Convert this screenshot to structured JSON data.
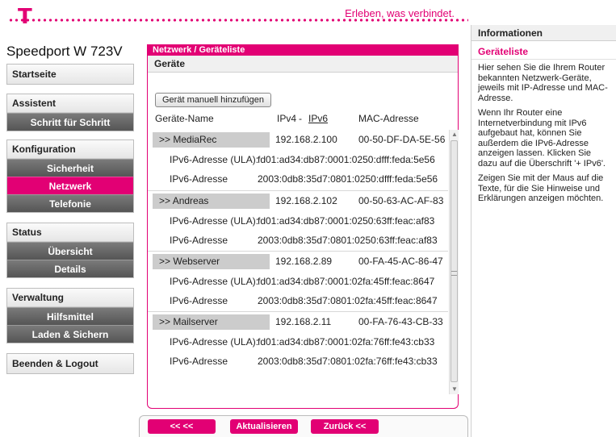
{
  "header": {
    "slogan": "Erleben, was verbindet.",
    "device": "Speedport W 723V",
    "logo": "T"
  },
  "nav": {
    "startseite": "Startseite",
    "assistent": "Assistent",
    "schritt": "Schritt für Schritt",
    "konfiguration": "Konfiguration",
    "sicherheit": "Sicherheit",
    "netzwerk": "Netzwerk",
    "telefonie": "Telefonie",
    "status": "Status",
    "uebersicht": "Übersicht",
    "details": "Details",
    "verwaltung": "Verwaltung",
    "hilfsmittel": "Hilfsmittel",
    "laden": "Laden & Sichern",
    "logout": "Beenden & Logout"
  },
  "main": {
    "breadcrumb": "Netzwerk / Geräteliste",
    "section": "Geräte",
    "add_button": "Gerät manuell hinzufügen",
    "col_name": "Geräte-Name",
    "col_ipv4": "IPv4",
    "col_sep": "-",
    "col_ipv6": "IPv6",
    "col_mac": "MAC-Adresse",
    "devices": [
      {
        "name": ">> MediaRec",
        "ip": "192.168.2.100",
        "mac": "00-50-DF-DA-5E-56",
        "ula_label": "IPv6-Adresse (ULA):",
        "ula": "fd01:ad34:db87:0001:0250:dfff:feda:5e56",
        "ipv6_label": "IPv6-Adresse",
        "ipv6": "2003:0db8:35d7:0801:0250:dfff:feda:5e56"
      },
      {
        "name": ">> Andreas",
        "ip": "192.168.2.102",
        "mac": "00-50-63-AC-AF-83",
        "ula_label": "IPv6-Adresse (ULA):",
        "ula": "fd01:ad34:db87:0001:0250:63ff:feac:af83",
        "ipv6_label": "IPv6-Adresse",
        "ipv6": "2003:0db8:35d7:0801:0250:63ff:feac:af83"
      },
      {
        "name": ">> Webserver",
        "ip": "192.168.2.89",
        "mac": "00-FA-45-AC-86-47",
        "ula_label": "IPv6-Adresse (ULA):",
        "ula": "fd01:ad34:db87:0001:02fa:45ff:feac:8647",
        "ipv6_label": "IPv6-Adresse",
        "ipv6": "2003:0db8:35d7:0801:02fa:45ff:feac:8647"
      },
      {
        "name": ">> Mailserver",
        "ip": "192.168.2.11",
        "mac": "00-FA-76-43-CB-33",
        "ula_label": "IPv6-Adresse (ULA):",
        "ula": "fd01:ad34:db87:0001:02fa:76ff:fe43:cb33",
        "ipv6_label": "IPv6-Adresse",
        "ipv6": "2003:0db8:35d7:0801:02fa:76ff:fe43:cb33"
      }
    ]
  },
  "buttons": {
    "back_arrows": "<< <<",
    "refresh": "Aktualisieren",
    "back": "Zurück <<"
  },
  "info": {
    "heading": "Informationen",
    "title": "Geräteliste",
    "p1": "Hier sehen Sie die Ihrem Router bekannten Netzwerk-Geräte, jeweils mit IP-Adresse und MAC-Adresse.",
    "p2": "Wenn Ihr Router eine Internetverbindung mit IPv6 aufgebaut hat, können Sie außerdem die IPv6-Adresse anzeigen lassen. Klicken Sie dazu auf die Überschrift '+ IPv6'.",
    "p3": "Zeigen Sie mit der Maus auf die Texte, für die Sie Hinweise und Erklärungen anzeigen möchten."
  },
  "colors": {
    "brand": "#e20074",
    "nav_dark": "#666666",
    "device_label_bg": "#cccccc"
  }
}
